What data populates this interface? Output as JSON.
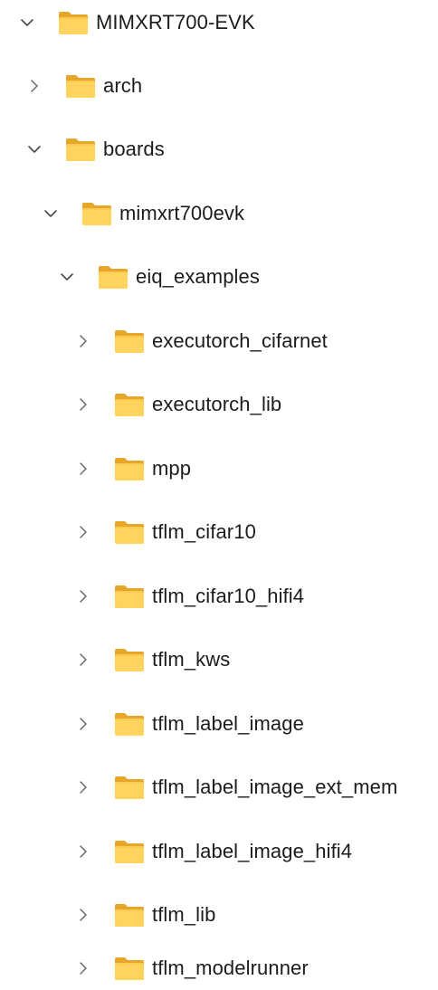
{
  "tree": {
    "root": {
      "label": "MIMXRT700-EVK",
      "expanded": true,
      "icon": "folder-icon"
    },
    "arch": {
      "label": "arch",
      "expanded": false,
      "icon": "folder-icon"
    },
    "boards": {
      "label": "boards",
      "expanded": true,
      "icon": "folder-icon"
    },
    "mimxrt700evk": {
      "label": "mimxrt700evk",
      "expanded": true,
      "icon": "folder-icon"
    },
    "eiq_examples": {
      "label": "eiq_examples",
      "expanded": true,
      "icon": "folder-icon"
    },
    "children": [
      {
        "label": "executorch_cifarnet",
        "expanded": false,
        "icon": "folder-icon"
      },
      {
        "label": "executorch_lib",
        "expanded": false,
        "icon": "folder-icon"
      },
      {
        "label": "mpp",
        "expanded": false,
        "icon": "folder-icon"
      },
      {
        "label": "tflm_cifar10",
        "expanded": false,
        "icon": "folder-icon"
      },
      {
        "label": "tflm_cifar10_hifi4",
        "expanded": false,
        "icon": "folder-icon"
      },
      {
        "label": "tflm_kws",
        "expanded": false,
        "icon": "folder-icon"
      },
      {
        "label": "tflm_label_image",
        "expanded": false,
        "icon": "folder-icon"
      },
      {
        "label": "tflm_label_image_ext_mem",
        "expanded": false,
        "icon": "folder-icon"
      },
      {
        "label": "tflm_label_image_hifi4",
        "expanded": false,
        "icon": "folder-icon"
      },
      {
        "label": "tflm_lib",
        "expanded": false,
        "icon": "folder-icon"
      },
      {
        "label": "tflm_modelrunner",
        "expanded": false,
        "icon": "folder-icon"
      }
    ]
  },
  "colors": {
    "folder_back": "#E8A92A",
    "folder_front": "#FFD35C",
    "chevron": "#5a5a5a",
    "text": "#1c1c1c"
  }
}
